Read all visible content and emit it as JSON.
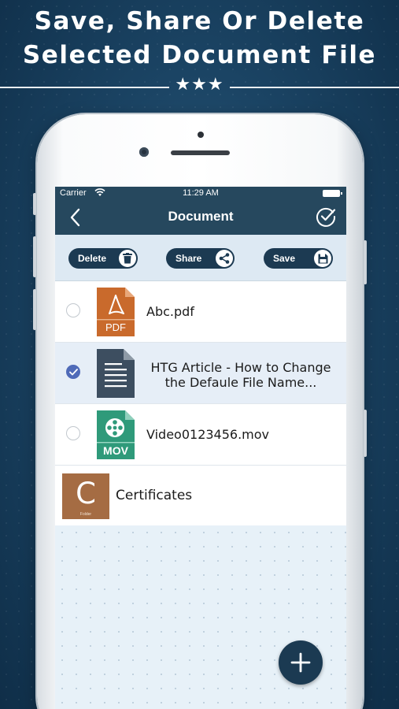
{
  "promo": {
    "headline_line1": "Save, Share Or Delete",
    "headline_line2": "Selected Document File",
    "stars": "★★★"
  },
  "status_bar": {
    "carrier": "Carrier",
    "time": "11:29 AM"
  },
  "navbar": {
    "title": "Document",
    "back_icon": "chevron-left-icon",
    "select_icon": "check-circle-icon"
  },
  "actions": {
    "delete_label": "Delete",
    "share_label": "Share",
    "save_label": "Save"
  },
  "files": [
    {
      "name": "Abc.pdf",
      "type_label": "PDF",
      "icon": "pdf-file-icon",
      "selected": false
    },
    {
      "name_line1": "HTG Article - How to Change",
      "name_line2": "the Defaule File Name...",
      "icon": "document-file-icon",
      "selected": true
    },
    {
      "name": "Video0123456.mov",
      "type_label": "MOV",
      "icon": "video-file-icon",
      "selected": false
    }
  ],
  "folder": {
    "letter": "C",
    "sublabel": "Folder",
    "name": "Certificates"
  },
  "colors": {
    "nav_bg": "#26485e",
    "pill_bg": "#1c3a52",
    "pdf_orange": "#c96a2c",
    "mov_green": "#2f9a7a",
    "doc_slate": "#3d4e60",
    "folder_brown": "#a56c43",
    "check_blue": "#4f6ab8"
  }
}
